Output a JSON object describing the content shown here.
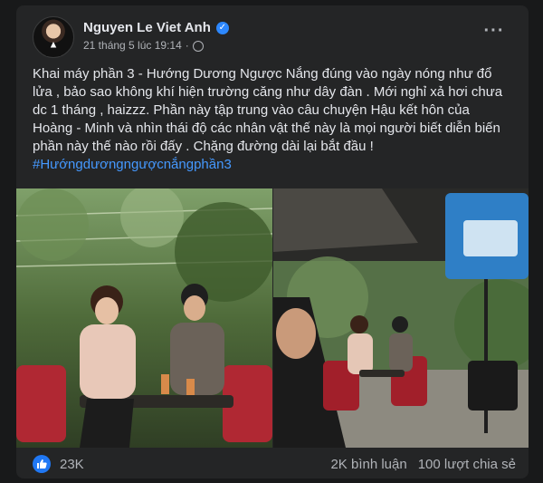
{
  "post": {
    "author": "Nguyen Le Viet Anh",
    "timestamp": "21 tháng 5 lúc 19:14",
    "privacy_icon": "globe-icon",
    "verified_icon": "verified-badge-icon",
    "more_icon": "more-options-icon",
    "text": "Khai máy phần 3 - Hướng Dương Ngược Nắng đúng vào ngày nóng như đổ lửa , bảo sao không khí hiện trường căng như dây đàn . Mới nghỉ xả hơi chưa dc 1 tháng , haizzz. Phần này tập trung vào câu chuyện Hậu kết hôn của Hoàng - Minh và nhìn thái độ các nhân vật thế này là mọi người biết diễn biến phần này thế nào rồi đấy . Chặng đường dài lại bắt đầu !",
    "hashtag": "#Hướngdươngngượcnắngphần3"
  },
  "stats": {
    "like_icon": "thumbs-up-icon",
    "likes": "23K",
    "comments": "2K bình luận",
    "shares": "100 lượt chia sẻ"
  },
  "colors": {
    "background": "#18191a",
    "card": "#242526",
    "text": "#e4e6eb",
    "secondary_text": "#b0b3b8",
    "link": "#4599ff",
    "accent": "#2078f4"
  }
}
